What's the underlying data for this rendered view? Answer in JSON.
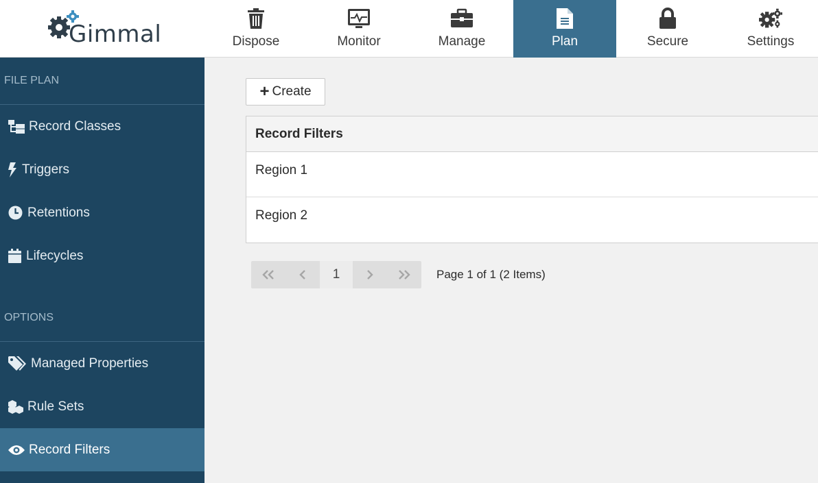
{
  "brand": {
    "name": "Gimmal"
  },
  "nav": [
    {
      "label": "Dispose",
      "icon": "trash-icon"
    },
    {
      "label": "Monitor",
      "icon": "monitor-icon"
    },
    {
      "label": "Manage",
      "icon": "briefcase-icon"
    },
    {
      "label": "Plan",
      "icon": "document-icon",
      "active": true
    },
    {
      "label": "Secure",
      "icon": "lock-icon"
    },
    {
      "label": "Settings",
      "icon": "gears-icon"
    }
  ],
  "sidebar": {
    "file_plan_header": "FILE PLAN",
    "file_plan_items": [
      {
        "label": "Record Classes",
        "icon": "sitemap-icon"
      },
      {
        "label": "Triggers",
        "icon": "bolt-icon"
      },
      {
        "label": "Retentions",
        "icon": "clock-icon"
      },
      {
        "label": "Lifecycles",
        "icon": "calendar-icon"
      }
    ],
    "options_header": "OPTIONS",
    "options_items": [
      {
        "label": "Managed Properties",
        "icon": "tags-icon"
      },
      {
        "label": "Rule Sets",
        "icon": "cubes-icon"
      },
      {
        "label": "Record Filters",
        "icon": "eye-icon",
        "active": true
      }
    ]
  },
  "toolbar": {
    "create_label": "Create"
  },
  "grid": {
    "header": "Record Filters",
    "rows": [
      "Region 1",
      "Region 2"
    ]
  },
  "pager": {
    "current_page": "1",
    "info": "Page 1 of 1 (2 Items)"
  },
  "colors": {
    "accent": "#3a6f8f",
    "sidebar_bg": "#1d4560"
  }
}
